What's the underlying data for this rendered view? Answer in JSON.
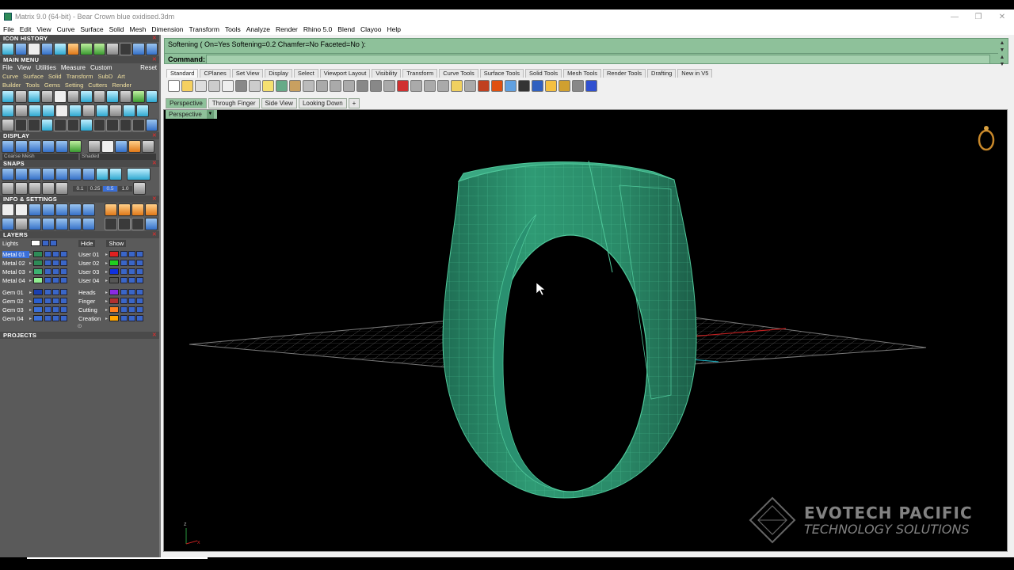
{
  "window": {
    "title": "Matrix 9.0 (64-bit) - Bear Crown blue oxidised.3dm",
    "controls": [
      "—",
      "❐",
      "✕"
    ]
  },
  "menubar": [
    "File",
    "Edit",
    "View",
    "Curve",
    "Surface",
    "Solid",
    "Mesh",
    "Dimension",
    "Transform",
    "Tools",
    "Analyze",
    "Render",
    "Rhino 5.0",
    "Blend",
    "Clayoo",
    "Help"
  ],
  "left": {
    "icon_history": "ICON HISTORY",
    "main_menu": "MAIN MENU",
    "main_tabs": [
      "File",
      "View",
      "Utilities",
      "Measure",
      "Custom"
    ],
    "reset": "Reset",
    "sub_row1": [
      "Curve",
      "Surface",
      "Solid",
      "Transform",
      "SubD",
      "Art"
    ],
    "sub_row2": [
      "Builder",
      "Tools",
      "Gems",
      "Setting",
      "Cutters",
      "Render"
    ],
    "display": "DISPLAY",
    "display_modes": [
      "Coarse Mesh",
      "Shaded"
    ],
    "snaps": "SNAPS",
    "snap_values": [
      "0.1",
      "0.25",
      "0.5",
      "1.0"
    ],
    "info_settings": "INFO & SETTINGS",
    "layers": "LAYERS",
    "lights": "Lights",
    "hide": "Hide",
    "show": "Show",
    "layers_left": [
      {
        "name": "Metal 01",
        "color": "#2e8b57",
        "selected": true
      },
      {
        "name": "Metal 02",
        "color": "#2e8b57",
        "selected": false
      },
      {
        "name": "Metal 03",
        "color": "#3cb371",
        "selected": false
      },
      {
        "name": "Metal 04",
        "color": "#90ee90",
        "selected": false
      },
      {
        "name": "Gem 01",
        "color": "#1a3fb0",
        "selected": false
      },
      {
        "name": "Gem 02",
        "color": "#2a5fd0",
        "selected": false
      },
      {
        "name": "Gem 03",
        "color": "#3a6fd8",
        "selected": false
      },
      {
        "name": "Gem 04",
        "color": "#3a6fd8",
        "selected": false
      }
    ],
    "layers_right": [
      {
        "name": "User 01",
        "color": "#e02020"
      },
      {
        "name": "User 02",
        "color": "#20d020"
      },
      {
        "name": "User 03",
        "color": "#1030e0"
      },
      {
        "name": "User 04",
        "color": "#555555"
      },
      {
        "name": "Heads",
        "color": "#8a2be2"
      },
      {
        "name": "Finger",
        "color": "#b03030"
      },
      {
        "name": "Cutting",
        "color": "#ff7f20"
      },
      {
        "name": "Creation",
        "color": "#ffa500"
      }
    ],
    "projects": "PROJECTS"
  },
  "command": {
    "history": "Softening ( On=Yes  Softening=0.2  Chamfer=No  Faceted=No ):",
    "label": "Command:",
    "value": ""
  },
  "toolbar_tabs": [
    "Standard",
    "CPlanes",
    "Set View",
    "Display",
    "Select",
    "Viewport Layout",
    "Visibility",
    "Transform",
    "Curve Tools",
    "Surface Tools",
    "Solid Tools",
    "Mesh Tools",
    "Render Tools",
    "Drafting",
    "New in V5"
  ],
  "viewport_tabs": [
    "Perspective",
    "Through Finger",
    "Side View",
    "Looking Down",
    "+"
  ],
  "viewport": {
    "label": "Perspective",
    "watermark_line1": "EVOTECH PACIFIC",
    "watermark_line2": "TECHNOLOGY SOLUTIONS",
    "ring_color": "#2f8a6a",
    "ring_wire_color": "#4fc79a"
  }
}
